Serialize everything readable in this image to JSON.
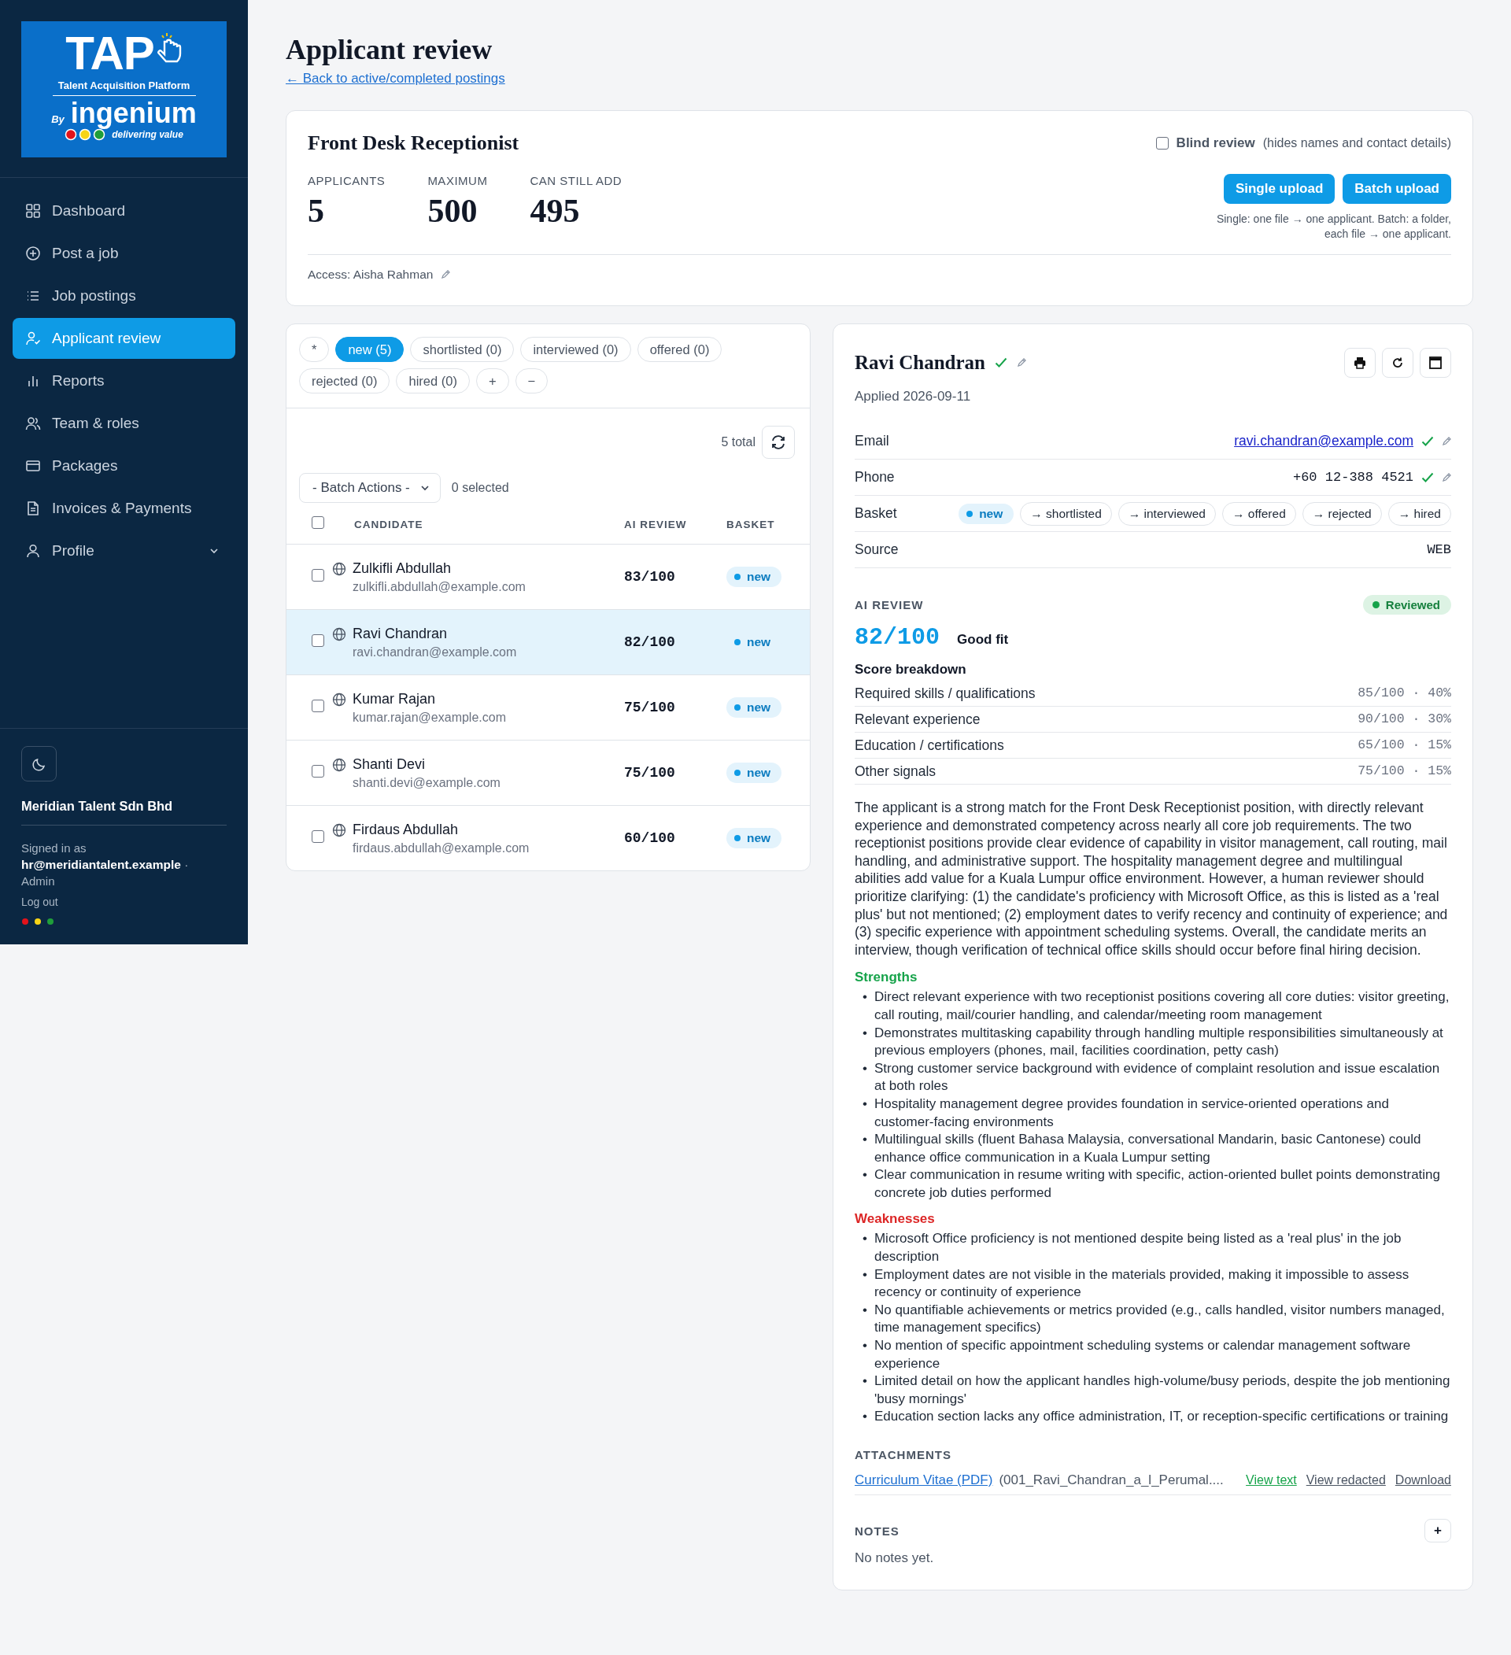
{
  "logo": {
    "title": "TAP",
    "subtitle": "Talent Acquisition Platform",
    "by": "By",
    "brand": "ingenium",
    "tagline": "delivering value"
  },
  "sidebar": {
    "items": [
      {
        "label": "Dashboard",
        "selected": false
      },
      {
        "label": "Post a job",
        "selected": false
      },
      {
        "label": "Job postings",
        "selected": false
      },
      {
        "label": "Applicant review",
        "selected": true
      },
      {
        "label": "Reports",
        "selected": false
      },
      {
        "label": "Team & roles",
        "selected": false
      },
      {
        "label": "Packages",
        "selected": false
      },
      {
        "label": "Invoices & Payments",
        "selected": false
      },
      {
        "label": "Profile",
        "selected": false,
        "expanded": false
      }
    ],
    "company": "Meridian Talent Sdn Bhd",
    "signed_in_label": "Signed in as",
    "email": "hr@meridiantalent.example",
    "separator": "·",
    "role": "Admin",
    "logout": "Log out"
  },
  "page": {
    "title": "Applicant review",
    "back_link": "← Back to active/completed postings"
  },
  "posting": {
    "title": "Front Desk Receptionist",
    "blind_review": {
      "label": "Blind review",
      "hint": "(hides names and contact details)",
      "checked": false
    },
    "stats": [
      {
        "label": "APPLICANTS",
        "value": "5"
      },
      {
        "label": "MAXIMUM",
        "value": "500"
      },
      {
        "label": "CAN STILL ADD",
        "value": "495"
      }
    ],
    "buttons": [
      "Single upload",
      "Batch upload"
    ],
    "upload_hint": [
      "Single: one file → one applicant. Batch: a folder,",
      "each file → one applicant."
    ],
    "access": "Access: Aisha Rahman"
  },
  "filters": [
    {
      "label": "*",
      "selected": false
    },
    {
      "label": "new (5)",
      "selected": true
    },
    {
      "label": "shortlisted (0)",
      "selected": false
    },
    {
      "label": "interviewed (0)",
      "selected": false
    },
    {
      "label": "offered (0)",
      "selected": false
    },
    {
      "label": "rejected (0)",
      "selected": false
    },
    {
      "label": "hired (0)",
      "selected": false
    },
    {
      "label": "+",
      "selected": false
    },
    {
      "label": "−",
      "selected": false
    }
  ],
  "list": {
    "total": "5 total",
    "batch_actions": "- Batch Actions -",
    "selected_count": "0 selected",
    "select_all": false,
    "columns": [
      "CANDIDATE",
      "AI REVIEW",
      "BASKET"
    ],
    "rows": [
      {
        "name": "Zulkifli Abdullah",
        "email": "zulkifli.abdullah@example.com",
        "score": "83/100",
        "basket": "new",
        "checked": false,
        "selected": false
      },
      {
        "name": "Ravi Chandran",
        "email": "ravi.chandran@example.com",
        "score": "82/100",
        "basket": "new",
        "checked": false,
        "selected": true
      },
      {
        "name": "Kumar Rajan",
        "email": "kumar.rajan@example.com",
        "score": "75/100",
        "basket": "new",
        "checked": false,
        "selected": false
      },
      {
        "name": "Shanti Devi",
        "email": "shanti.devi@example.com",
        "score": "75/100",
        "basket": "new",
        "checked": false,
        "selected": false
      },
      {
        "name": "Firdaus Abdullah",
        "email": "firdaus.abdullah@example.com",
        "score": "60/100",
        "basket": "new",
        "checked": false,
        "selected": false
      }
    ]
  },
  "detail": {
    "name": "Ravi Chandran",
    "name_verified": true,
    "applied": "Applied 2026-09-11",
    "email": {
      "label": "Email",
      "value": "ravi.chandran@example.com",
      "verified": true
    },
    "phone": {
      "label": "Phone",
      "value": "+60 12-388 4521",
      "verified": true
    },
    "basket": {
      "label": "Basket",
      "current": "new",
      "moves": [
        "→ shortlisted",
        "→ interviewed",
        "→ offered",
        "→ rejected",
        "→ hired"
      ]
    },
    "source": {
      "label": "Source",
      "value": "WEB"
    },
    "ai_review": {
      "heading": "AI REVIEW",
      "status": "Reviewed",
      "score": "82/100",
      "verdict": "Good fit",
      "breakdown_title": "Score breakdown",
      "breakdown": [
        {
          "label": "Required skills / qualifications",
          "value": "85/100 · 40%"
        },
        {
          "label": "Relevant experience",
          "value": "90/100 · 30%"
        },
        {
          "label": "Education / certifications",
          "value": "65/100 · 15%"
        },
        {
          "label": "Other signals",
          "value": "75/100 · 15%"
        }
      ],
      "summary": "The applicant is a strong match for the Front Desk Receptionist position, with directly relevant experience and demonstrated competency across nearly all core job requirements. The two receptionist positions provide clear evidence of capability in visitor management, call routing, mail handling, and administrative support. The hospitality management degree and multilingual abilities add value for a Kuala Lumpur office environment. However, a human reviewer should prioritize clarifying: (1) the candidate's proficiency with Microsoft Office, as this is listed as a 'real plus' but not mentioned; (2) employment dates to verify recency and continuity of experience; and (3) specific experience with appointment scheduling systems. Overall, the candidate merits an interview, though verification of technical office skills should occur before final hiring decision.",
      "bullet": "•",
      "strengths_title": "Strengths",
      "strengths": [
        "Direct relevant experience with two receptionist positions covering all core duties: visitor greeting, call routing, mail/courier handling, and calendar/meeting room management",
        "Demonstrates multitasking capability through handling multiple responsibilities simultaneously at previous employers (phones, mail, facilities coordination, petty cash)",
        "Strong customer service background with evidence of complaint resolution and issue escalation at both roles",
        "Hospitality management degree provides foundation in service-oriented operations and customer-facing environments",
        "Multilingual skills (fluent Bahasa Malaysia, conversational Mandarin, basic Cantonese) could enhance office communication in a Kuala Lumpur setting",
        "Clear communication in resume writing with specific, action-oriented bullet points demonstrating concrete job duties performed"
      ],
      "weaknesses_title": "Weaknesses",
      "weaknesses": [
        "Microsoft Office proficiency is not mentioned despite being listed as a 'real plus' in the job description",
        "Employment dates are not visible in the materials provided, making it impossible to assess recency or continuity of experience",
        "No quantifiable achievements or metrics provided (e.g., calls handled, visitor numbers managed, time management specifics)",
        "No mention of specific appointment scheduling systems or calendar management software experience",
        "Limited detail on how the applicant handles high-volume/busy periods, despite the job mentioning 'busy mornings'",
        "Education section lacks any office administration, IT, or reception-specific certifications or training"
      ]
    },
    "attachments": {
      "heading": "ATTACHMENTS",
      "link": "Curriculum Vitae (PDF)",
      "file": "(001_Ravi_Chandran_a_l_Perumal....",
      "actions": [
        "View text",
        "View redacted",
        "Download"
      ]
    },
    "notes": {
      "heading": "NOTES",
      "add": "+",
      "empty": "No notes yet."
    }
  }
}
